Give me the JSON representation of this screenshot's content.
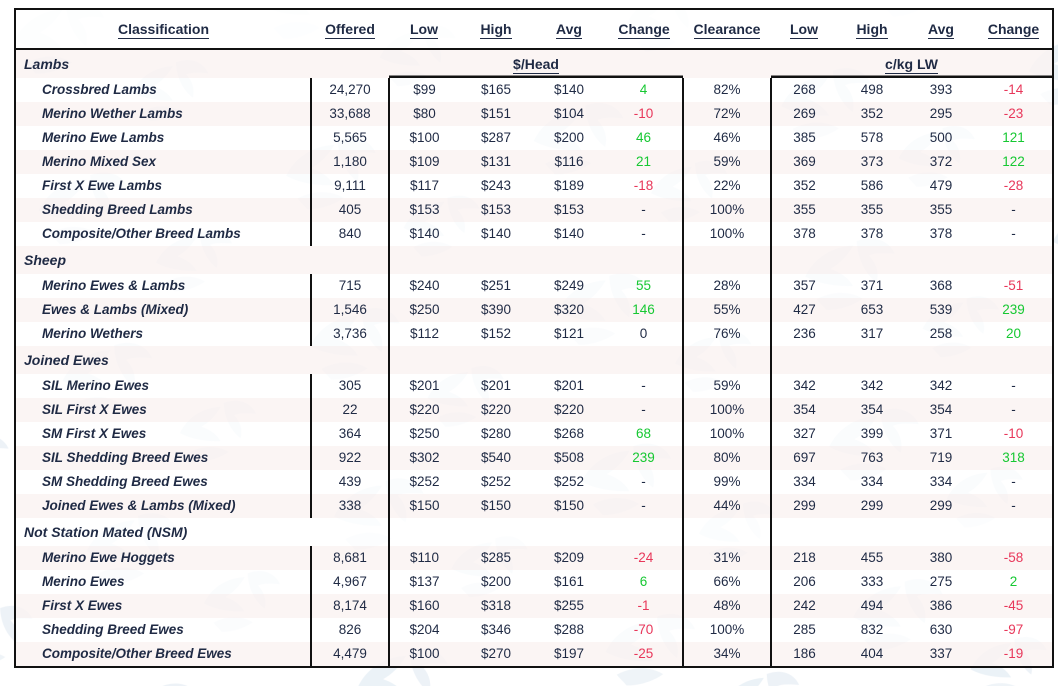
{
  "table": {
    "headers": {
      "classification": "Classification",
      "offered": "Offered",
      "low1": "Low",
      "high1": "High",
      "avg1": "Avg",
      "change1": "Change",
      "clearance": "Clearance",
      "low2": "Low",
      "high2": "High",
      "avg2": "Avg",
      "change2": "Change"
    },
    "units": {
      "dollars_per_head": "$/Head",
      "cents_per_kg": "c/kg LW"
    },
    "colors": {
      "positive": "#16c832",
      "negative": "#e8375a",
      "text": "#1f2a44",
      "stripe": "#faf3f2",
      "border": "#111111"
    },
    "rows": [
      {
        "type": "section",
        "name": "Lambs"
      },
      {
        "type": "data",
        "name": "Crossbred Lambs",
        "offered": "24,270",
        "low1": "$99",
        "high1": "$165",
        "avg1": "$140",
        "change1": "4",
        "change1_sign": "pos",
        "clearance": "82%",
        "low2": "268",
        "high2": "498",
        "avg2": "393",
        "change2": "-14",
        "change2_sign": "neg"
      },
      {
        "type": "data",
        "name": "Merino Wether Lambs",
        "offered": "33,688",
        "low1": "$80",
        "high1": "$151",
        "avg1": "$104",
        "change1": "-10",
        "change1_sign": "neg",
        "clearance": "72%",
        "low2": "269",
        "high2": "352",
        "avg2": "295",
        "change2": "-23",
        "change2_sign": "neg"
      },
      {
        "type": "data",
        "name": "Merino Ewe Lambs",
        "offered": "5,565",
        "low1": "$100",
        "high1": "$287",
        "avg1": "$200",
        "change1": "46",
        "change1_sign": "pos",
        "clearance": "46%",
        "low2": "385",
        "high2": "578",
        "avg2": "500",
        "change2": "121",
        "change2_sign": "pos"
      },
      {
        "type": "data",
        "name": "Merino Mixed Sex",
        "offered": "1,180",
        "low1": "$109",
        "high1": "$131",
        "avg1": "$116",
        "change1": "21",
        "change1_sign": "pos",
        "clearance": "59%",
        "low2": "369",
        "high2": "373",
        "avg2": "372",
        "change2": "122",
        "change2_sign": "pos"
      },
      {
        "type": "data",
        "name": "First X Ewe Lambs",
        "offered": "9,111",
        "low1": "$117",
        "high1": "$243",
        "avg1": "$189",
        "change1": "-18",
        "change1_sign": "neg",
        "clearance": "22%",
        "low2": "352",
        "high2": "586",
        "avg2": "479",
        "change2": "-28",
        "change2_sign": "neg"
      },
      {
        "type": "data",
        "name": "Shedding Breed Lambs",
        "offered": "405",
        "low1": "$153",
        "high1": "$153",
        "avg1": "$153",
        "change1": "-",
        "change1_sign": "dash",
        "clearance": "100%",
        "low2": "355",
        "high2": "355",
        "avg2": "355",
        "change2": "-",
        "change2_sign": "dash"
      },
      {
        "type": "data",
        "name": "Composite/Other Breed Lambs",
        "offered": "840",
        "low1": "$140",
        "high1": "$140",
        "avg1": "$140",
        "change1": "-",
        "change1_sign": "dash",
        "clearance": "100%",
        "low2": "378",
        "high2": "378",
        "avg2": "378",
        "change2": "-",
        "change2_sign": "dash"
      },
      {
        "type": "section",
        "name": "Sheep"
      },
      {
        "type": "data",
        "name": "Merino Ewes & Lambs",
        "offered": "715",
        "low1": "$240",
        "high1": "$251",
        "avg1": "$249",
        "change1": "55",
        "change1_sign": "pos",
        "clearance": "28%",
        "low2": "357",
        "high2": "371",
        "avg2": "368",
        "change2": "-51",
        "change2_sign": "neg"
      },
      {
        "type": "data",
        "name": "Ewes & Lambs (Mixed)",
        "offered": "1,546",
        "low1": "$250",
        "high1": "$390",
        "avg1": "$320",
        "change1": "146",
        "change1_sign": "pos",
        "clearance": "55%",
        "low2": "427",
        "high2": "653",
        "avg2": "539",
        "change2": "239",
        "change2_sign": "pos"
      },
      {
        "type": "data",
        "name": "Merino Wethers",
        "offered": "3,736",
        "low1": "$112",
        "high1": "$152",
        "avg1": "$121",
        "change1": "0",
        "change1_sign": "zero",
        "clearance": "76%",
        "low2": "236",
        "high2": "317",
        "avg2": "258",
        "change2": "20",
        "change2_sign": "pos"
      },
      {
        "type": "section",
        "name": "Joined Ewes"
      },
      {
        "type": "data",
        "name": "SIL Merino Ewes",
        "offered": "305",
        "low1": "$201",
        "high1": "$201",
        "avg1": "$201",
        "change1": "-",
        "change1_sign": "dash",
        "clearance": "59%",
        "low2": "342",
        "high2": "342",
        "avg2": "342",
        "change2": "-",
        "change2_sign": "dash"
      },
      {
        "type": "data",
        "name": "SIL First X Ewes",
        "offered": "22",
        "low1": "$220",
        "high1": "$220",
        "avg1": "$220",
        "change1": "-",
        "change1_sign": "dash",
        "clearance": "100%",
        "low2": "354",
        "high2": "354",
        "avg2": "354",
        "change2": "-",
        "change2_sign": "dash"
      },
      {
        "type": "data",
        "name": "SM First X Ewes",
        "offered": "364",
        "low1": "$250",
        "high1": "$280",
        "avg1": "$268",
        "change1": "68",
        "change1_sign": "pos",
        "clearance": "100%",
        "low2": "327",
        "high2": "399",
        "avg2": "371",
        "change2": "-10",
        "change2_sign": "neg"
      },
      {
        "type": "data",
        "name": "SIL Shedding Breed Ewes",
        "offered": "922",
        "low1": "$302",
        "high1": "$540",
        "avg1": "$508",
        "change1": "239",
        "change1_sign": "pos",
        "clearance": "80%",
        "low2": "697",
        "high2": "763",
        "avg2": "719",
        "change2": "318",
        "change2_sign": "pos"
      },
      {
        "type": "data",
        "name": "SM Shedding Breed Ewes",
        "offered": "439",
        "low1": "$252",
        "high1": "$252",
        "avg1": "$252",
        "change1": "-",
        "change1_sign": "dash",
        "clearance": "99%",
        "low2": "334",
        "high2": "334",
        "avg2": "334",
        "change2": "-",
        "change2_sign": "dash"
      },
      {
        "type": "data",
        "name": "Joined Ewes & Lambs (Mixed)",
        "offered": "338",
        "low1": "$150",
        "high1": "$150",
        "avg1": "$150",
        "change1": "-",
        "change1_sign": "dash",
        "clearance": "44%",
        "low2": "299",
        "high2": "299",
        "avg2": "299",
        "change2": "-",
        "change2_sign": "dash"
      },
      {
        "type": "section",
        "name": "Not Station Mated (NSM)"
      },
      {
        "type": "data",
        "name": "Merino Ewe Hoggets",
        "offered": "8,681",
        "low1": "$110",
        "high1": "$285",
        "avg1": "$209",
        "change1": "-24",
        "change1_sign": "neg",
        "clearance": "31%",
        "low2": "218",
        "high2": "455",
        "avg2": "380",
        "change2": "-58",
        "change2_sign": "neg"
      },
      {
        "type": "data",
        "name": "Merino Ewes",
        "offered": "4,967",
        "low1": "$137",
        "high1": "$200",
        "avg1": "$161",
        "change1": "6",
        "change1_sign": "pos",
        "clearance": "66%",
        "low2": "206",
        "high2": "333",
        "avg2": "275",
        "change2": "2",
        "change2_sign": "pos"
      },
      {
        "type": "data",
        "name": "First X Ewes",
        "offered": "8,174",
        "low1": "$160",
        "high1": "$318",
        "avg1": "$255",
        "change1": "-1",
        "change1_sign": "neg",
        "clearance": "48%",
        "low2": "242",
        "high2": "494",
        "avg2": "386",
        "change2": "-45",
        "change2_sign": "neg"
      },
      {
        "type": "data",
        "name": "Shedding Breed Ewes",
        "offered": "826",
        "low1": "$204",
        "high1": "$346",
        "avg1": "$288",
        "change1": "-70",
        "change1_sign": "neg",
        "clearance": "100%",
        "low2": "285",
        "high2": "832",
        "avg2": "630",
        "change2": "-97",
        "change2_sign": "neg"
      },
      {
        "type": "data",
        "name": "Composite/Other Breed Ewes",
        "offered": "4,479",
        "low1": "$100",
        "high1": "$270",
        "avg1": "$197",
        "change1": "-25",
        "change1_sign": "neg",
        "clearance": "34%",
        "low2": "186",
        "high2": "404",
        "avg2": "337",
        "change2": "-19",
        "change2_sign": "neg"
      }
    ]
  }
}
